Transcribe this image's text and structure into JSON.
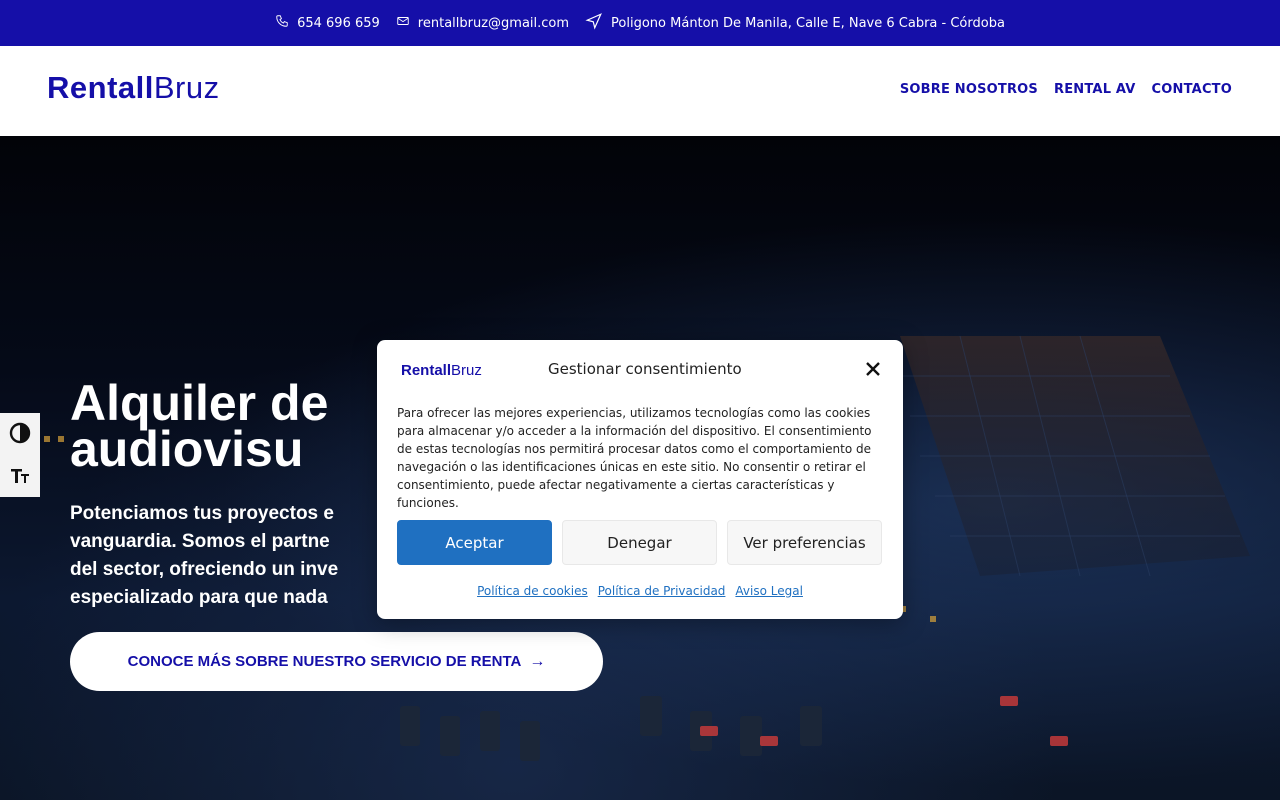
{
  "topbar": {
    "phone": "654 696 659",
    "email": "rentallbruz@gmail.com",
    "address": "Poligono Mánton De Manila, Calle E, Nave 6 Cabra - Córdoba"
  },
  "header": {
    "logo_bold": "Rentall",
    "logo_light": "Bruz",
    "nav": [
      "SOBRE NOSOTROS",
      "RENTAL AV",
      "CONTACTO"
    ]
  },
  "hero": {
    "title": "Alquiler de\naudiovisu",
    "subtitle": "Potenciamos tus proyectos e\nvanguardia. Somos el partne\ndel sector, ofreciendo un inve\nespecializado para que nada",
    "cta": "CONOCE MÁS SOBRE NUESTRO SERVICIO DE RENTA",
    "cta_arrow": "→"
  },
  "modal": {
    "logo_bold": "Rentall",
    "logo_light": "Bruz",
    "title": "Gestionar consentimiento",
    "text": "Para ofrecer las mejores experiencias, utilizamos tecnologías como las cookies para almacenar y/o acceder a la información del dispositivo. El consentimiento de estas tecnologías nos permitirá procesar datos como el comportamiento de navegación o las identificaciones únicas en este sitio. No consentir o retirar el consentimiento, puede afectar negativamente a ciertas características y funciones.",
    "accept": "Aceptar",
    "deny": "Denegar",
    "preferences": "Ver preferencias",
    "links": [
      "Política de cookies",
      "Política de Privacidad",
      "Aviso Legal"
    ]
  },
  "colors": {
    "brand": "#150fa8",
    "accept": "#1f70c1"
  }
}
